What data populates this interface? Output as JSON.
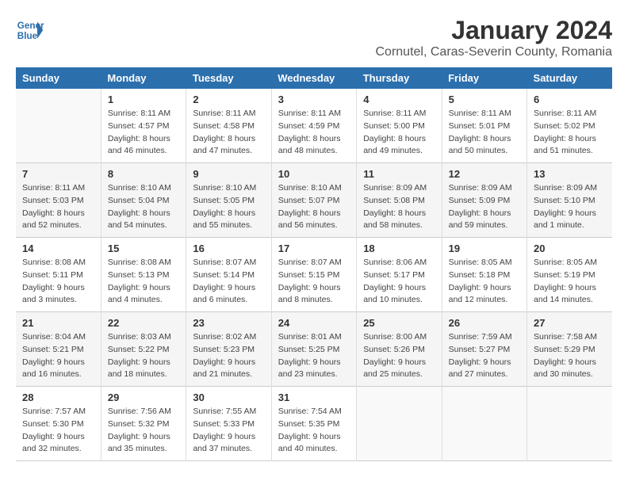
{
  "logo": {
    "line1": "General",
    "line2": "Blue"
  },
  "title": "January 2024",
  "subtitle": "Cornutel, Caras-Severin County, Romania",
  "days_header": [
    "Sunday",
    "Monday",
    "Tuesday",
    "Wednesday",
    "Thursday",
    "Friday",
    "Saturday"
  ],
  "weeks": [
    [
      {
        "num": "",
        "info": ""
      },
      {
        "num": "1",
        "info": "Sunrise: 8:11 AM\nSunset: 4:57 PM\nDaylight: 8 hours\nand 46 minutes."
      },
      {
        "num": "2",
        "info": "Sunrise: 8:11 AM\nSunset: 4:58 PM\nDaylight: 8 hours\nand 47 minutes."
      },
      {
        "num": "3",
        "info": "Sunrise: 8:11 AM\nSunset: 4:59 PM\nDaylight: 8 hours\nand 48 minutes."
      },
      {
        "num": "4",
        "info": "Sunrise: 8:11 AM\nSunset: 5:00 PM\nDaylight: 8 hours\nand 49 minutes."
      },
      {
        "num": "5",
        "info": "Sunrise: 8:11 AM\nSunset: 5:01 PM\nDaylight: 8 hours\nand 50 minutes."
      },
      {
        "num": "6",
        "info": "Sunrise: 8:11 AM\nSunset: 5:02 PM\nDaylight: 8 hours\nand 51 minutes."
      }
    ],
    [
      {
        "num": "7",
        "info": "Sunrise: 8:11 AM\nSunset: 5:03 PM\nDaylight: 8 hours\nand 52 minutes."
      },
      {
        "num": "8",
        "info": "Sunrise: 8:10 AM\nSunset: 5:04 PM\nDaylight: 8 hours\nand 54 minutes."
      },
      {
        "num": "9",
        "info": "Sunrise: 8:10 AM\nSunset: 5:05 PM\nDaylight: 8 hours\nand 55 minutes."
      },
      {
        "num": "10",
        "info": "Sunrise: 8:10 AM\nSunset: 5:07 PM\nDaylight: 8 hours\nand 56 minutes."
      },
      {
        "num": "11",
        "info": "Sunrise: 8:09 AM\nSunset: 5:08 PM\nDaylight: 8 hours\nand 58 minutes."
      },
      {
        "num": "12",
        "info": "Sunrise: 8:09 AM\nSunset: 5:09 PM\nDaylight: 8 hours\nand 59 minutes."
      },
      {
        "num": "13",
        "info": "Sunrise: 8:09 AM\nSunset: 5:10 PM\nDaylight: 9 hours\nand 1 minute."
      }
    ],
    [
      {
        "num": "14",
        "info": "Sunrise: 8:08 AM\nSunset: 5:11 PM\nDaylight: 9 hours\nand 3 minutes."
      },
      {
        "num": "15",
        "info": "Sunrise: 8:08 AM\nSunset: 5:13 PM\nDaylight: 9 hours\nand 4 minutes."
      },
      {
        "num": "16",
        "info": "Sunrise: 8:07 AM\nSunset: 5:14 PM\nDaylight: 9 hours\nand 6 minutes."
      },
      {
        "num": "17",
        "info": "Sunrise: 8:07 AM\nSunset: 5:15 PM\nDaylight: 9 hours\nand 8 minutes."
      },
      {
        "num": "18",
        "info": "Sunrise: 8:06 AM\nSunset: 5:17 PM\nDaylight: 9 hours\nand 10 minutes."
      },
      {
        "num": "19",
        "info": "Sunrise: 8:05 AM\nSunset: 5:18 PM\nDaylight: 9 hours\nand 12 minutes."
      },
      {
        "num": "20",
        "info": "Sunrise: 8:05 AM\nSunset: 5:19 PM\nDaylight: 9 hours\nand 14 minutes."
      }
    ],
    [
      {
        "num": "21",
        "info": "Sunrise: 8:04 AM\nSunset: 5:21 PM\nDaylight: 9 hours\nand 16 minutes."
      },
      {
        "num": "22",
        "info": "Sunrise: 8:03 AM\nSunset: 5:22 PM\nDaylight: 9 hours\nand 18 minutes."
      },
      {
        "num": "23",
        "info": "Sunrise: 8:02 AM\nSunset: 5:23 PM\nDaylight: 9 hours\nand 21 minutes."
      },
      {
        "num": "24",
        "info": "Sunrise: 8:01 AM\nSunset: 5:25 PM\nDaylight: 9 hours\nand 23 minutes."
      },
      {
        "num": "25",
        "info": "Sunrise: 8:00 AM\nSunset: 5:26 PM\nDaylight: 9 hours\nand 25 minutes."
      },
      {
        "num": "26",
        "info": "Sunrise: 7:59 AM\nSunset: 5:27 PM\nDaylight: 9 hours\nand 27 minutes."
      },
      {
        "num": "27",
        "info": "Sunrise: 7:58 AM\nSunset: 5:29 PM\nDaylight: 9 hours\nand 30 minutes."
      }
    ],
    [
      {
        "num": "28",
        "info": "Sunrise: 7:57 AM\nSunset: 5:30 PM\nDaylight: 9 hours\nand 32 minutes."
      },
      {
        "num": "29",
        "info": "Sunrise: 7:56 AM\nSunset: 5:32 PM\nDaylight: 9 hours\nand 35 minutes."
      },
      {
        "num": "30",
        "info": "Sunrise: 7:55 AM\nSunset: 5:33 PM\nDaylight: 9 hours\nand 37 minutes."
      },
      {
        "num": "31",
        "info": "Sunrise: 7:54 AM\nSunset: 5:35 PM\nDaylight: 9 hours\nand 40 minutes."
      },
      {
        "num": "",
        "info": ""
      },
      {
        "num": "",
        "info": ""
      },
      {
        "num": "",
        "info": ""
      }
    ]
  ]
}
